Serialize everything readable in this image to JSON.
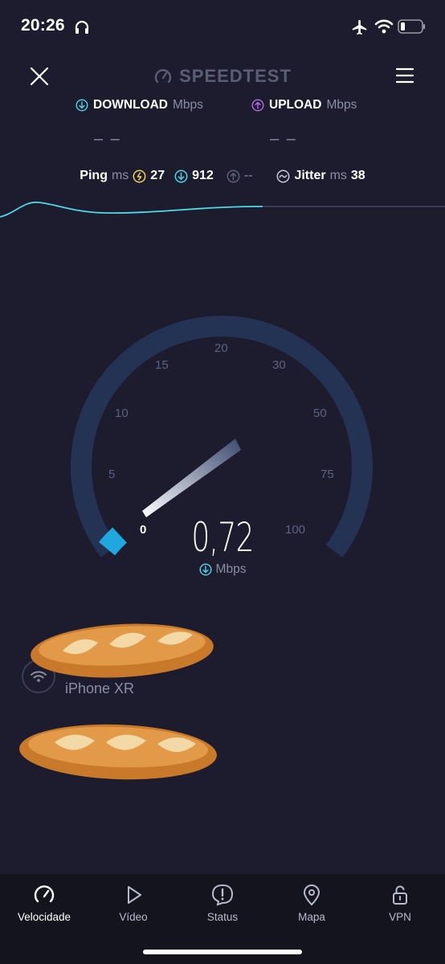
{
  "status_bar": {
    "time": "20:26",
    "icons": [
      "headphones-icon",
      "airplane-icon",
      "wifi-icon",
      "battery-icon"
    ]
  },
  "header": {
    "brand": "SPEEDTEST",
    "close_icon": "close-icon",
    "menu_icon": "menu-icon"
  },
  "metrics": {
    "download": {
      "label": "DOWNLOAD",
      "unit": "Mbps",
      "value": "– –",
      "color": "#4fd8e8"
    },
    "upload": {
      "label": "UPLOAD",
      "unit": "Mbps",
      "value": "– –",
      "color": "#b86be8"
    }
  },
  "ping": {
    "label": "Ping",
    "unit": "ms",
    "idle": "27",
    "download": "912",
    "upload": "--",
    "jitter_label": "Jitter",
    "jitter_unit": "ms",
    "jitter": "38"
  },
  "gauge": {
    "ticks": [
      "0",
      "5",
      "10",
      "15",
      "20",
      "30",
      "50",
      "75",
      "100"
    ],
    "value": "0,72",
    "unit": "Mbps",
    "level_fraction": 0.02,
    "accent_color": "#1fa8e0"
  },
  "device": {
    "name": "iPhone XR"
  },
  "nav": {
    "items": [
      {
        "label": "Velocidade",
        "icon": "speedometer-icon"
      },
      {
        "label": "Vídeo",
        "icon": "play-icon"
      },
      {
        "label": "Status",
        "icon": "alert-icon"
      },
      {
        "label": "Mapa",
        "icon": "map-pin-icon"
      },
      {
        "label": "VPN",
        "icon": "lock-icon"
      }
    ]
  }
}
